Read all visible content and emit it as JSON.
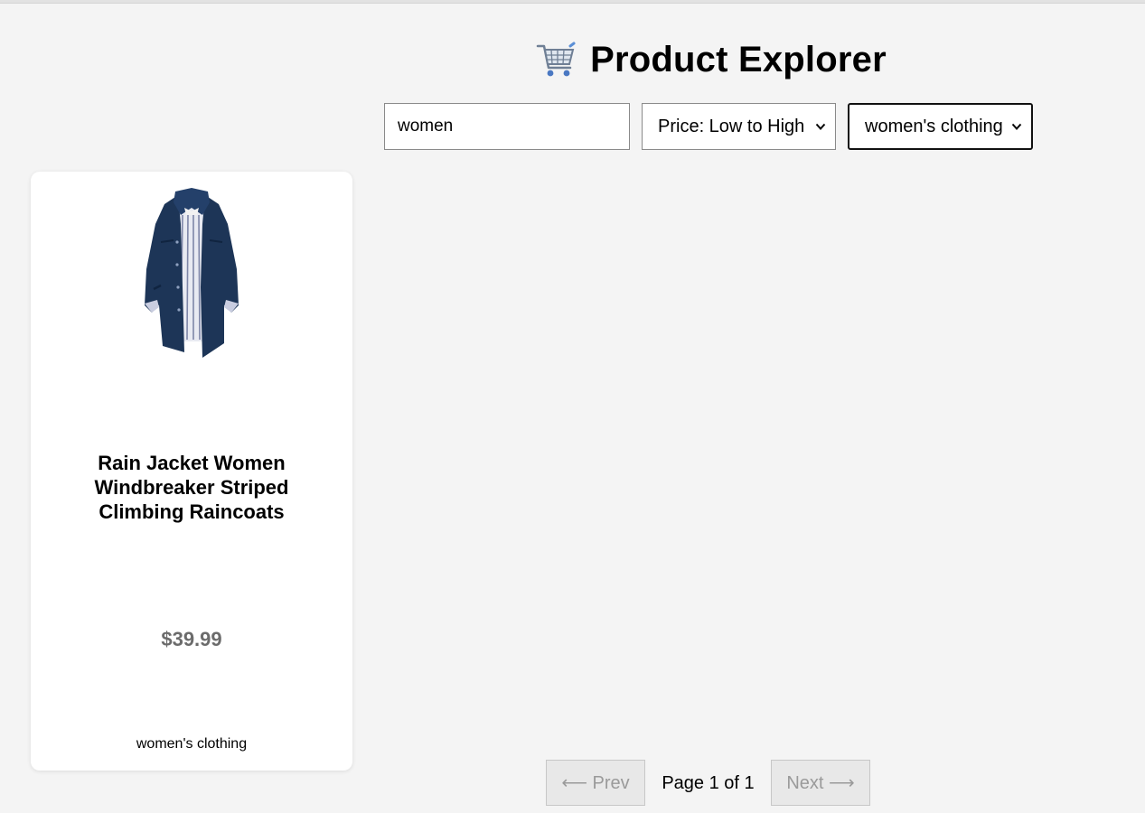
{
  "header": {
    "title": "Product Explorer",
    "icon": "shopping-cart-icon"
  },
  "filters": {
    "search_value": "women",
    "sort_selected": "Price: Low to High",
    "category_selected": "women's clothing"
  },
  "products": [
    {
      "title": "Rain Jacket Women Windbreaker Striped Climbing Raincoats",
      "price": "$39.99",
      "category": "women's clothing",
      "image": "navy-rain-jacket-image"
    }
  ],
  "pagination": {
    "prev_label": "⟵ Prev",
    "next_label": "Next ⟶",
    "page_info": "Page 1 of 1"
  },
  "colors": {
    "background": "#f4f4f4",
    "card": "#ffffff",
    "price": "#6b6b6b",
    "jacket": "#1d3557"
  }
}
